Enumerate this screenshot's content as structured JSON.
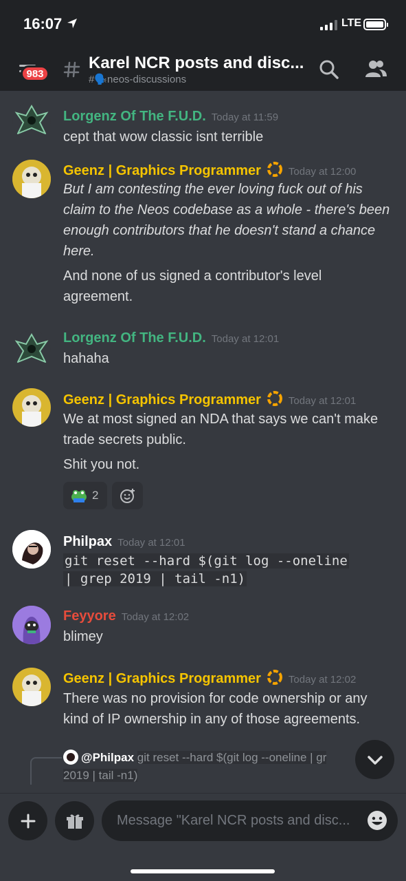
{
  "status_bar": {
    "time": "16:07",
    "network": "LTE"
  },
  "header": {
    "unread_badge": "983",
    "title": "Karel NCR posts and disc...",
    "subtitle": "#🗣️neos-discussions"
  },
  "messages": [
    {
      "author": "Lorgenz Of The F.U.D.",
      "timestamp": "Today at 11:59",
      "text": "cept that wow classic isnt terrible"
    },
    {
      "author": "Geenz | Graphics Programmer",
      "timestamp": "Today at 12:00",
      "text_italic": "But I am contesting the ever loving fuck out of his claim to the Neos codebase as a whole - there's been enough contributors that he doesn't stand a chance here.",
      "text": "And none of us signed a contributor's level agreement."
    },
    {
      "author": "Lorgenz Of The F.U.D.",
      "timestamp": "Today at 12:01",
      "text": "hahaha"
    },
    {
      "author": "Geenz | Graphics Programmer",
      "timestamp": "Today at 12:01",
      "text": "We at most signed an NDA that says we can't make trade secrets public.",
      "text2": "Shit you not.",
      "reaction_count": "2"
    },
    {
      "author": "Philpax",
      "timestamp": "Today at 12:01",
      "code_line1": "git reset --hard $(git log --oneline",
      "code_line2": "| grep 2019 | tail -n1)"
    },
    {
      "author": "Feyyore",
      "timestamp": "Today at 12:02",
      "text": "blimey"
    },
    {
      "author": "Geenz | Graphics Programmer",
      "timestamp": "Today at 12:02",
      "text": "There was no provision for code ownership or any kind of IP ownership in any of those agreements."
    },
    {
      "reply_mention": "@Philpax",
      "reply_text": "git reset --hard $(git log --oneline | gr",
      "reply_text2": "2019 | tail -n1)"
    }
  ],
  "composer": {
    "placeholder": "Message \"Karel NCR posts and disc..."
  },
  "colors": {
    "background": "#36393f",
    "header": "#202225",
    "green_role": "#43b581",
    "yellow_role": "#f5c400",
    "red_role": "#e74c3c",
    "badge": "#ed4245"
  },
  "icons": [
    "location-arrow-icon",
    "hamburger-icon",
    "hash-icon",
    "search-icon",
    "members-icon",
    "frog-emoji-icon",
    "add-reaction-icon",
    "chevron-down-icon",
    "plus-icon",
    "gift-icon",
    "emoji-icon"
  ]
}
